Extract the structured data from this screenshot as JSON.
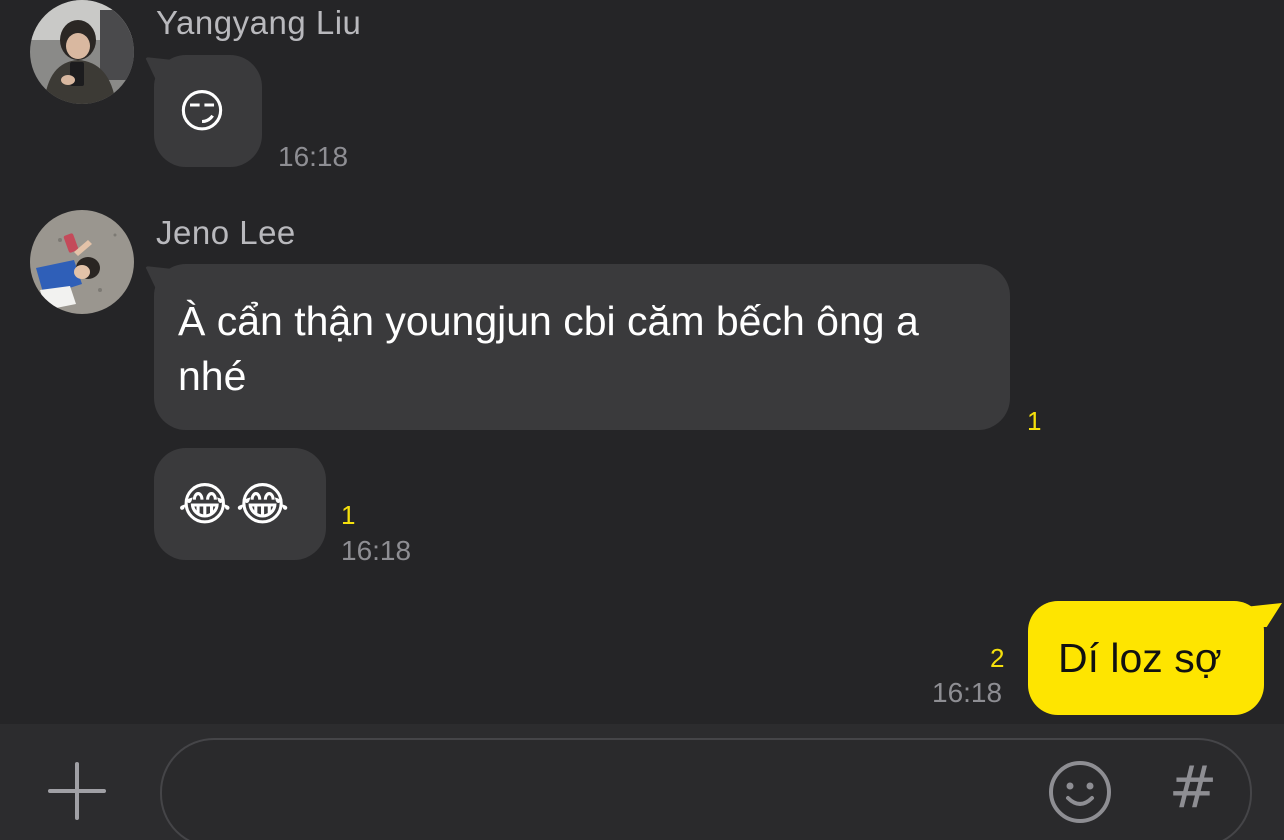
{
  "messages": [
    {
      "sender": "Yangyang Liu",
      "content": "😏",
      "time": "16:18",
      "unread": ""
    },
    {
      "sender": "Jeno Lee",
      "content": "À cẩn thận youngjun cbi căm bếch ông a nhé",
      "time": "",
      "unread": "1"
    },
    {
      "sender": "",
      "content": "😂😂",
      "time": "16:18",
      "unread": "1"
    }
  ],
  "my_message": {
    "content": "Dí loz sợ",
    "time": "16:18",
    "unread": "2"
  },
  "input_bar": {
    "placeholder": "",
    "value": "",
    "plus_icon": "plus-icon",
    "emoji_icon": "smiley-icon",
    "hash_label": "#"
  },
  "colors": {
    "background": "#252527",
    "incoming_bubble": "#3a3a3c",
    "outgoing_bubble": "#fee500",
    "unread_count": "#f5e00c",
    "timestamp": "#8e8e93"
  }
}
